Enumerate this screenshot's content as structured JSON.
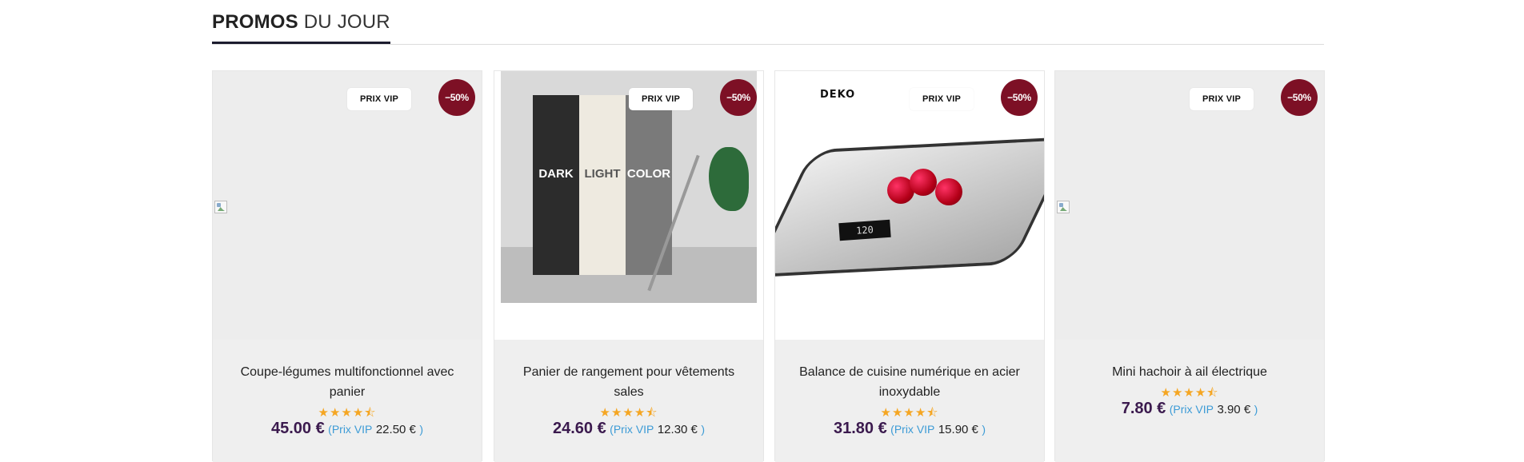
{
  "section": {
    "title_bold": "PROMOS",
    "title_light": "DU JOUR"
  },
  "products": [
    {
      "name": "Coupe-légumes multifonctionnel avec panier",
      "vip_tag": "PRIX VIP",
      "discount": "−50%",
      "rating_stars": "★★★★⯪",
      "rating": 4.5,
      "price": "45.00 €",
      "vip_open": "(Prix VIP",
      "vip_price": "22.50 €",
      "vip_close": ")",
      "image": "broken-image-icon"
    },
    {
      "name": "Panier de rangement pour vêtements sales",
      "vip_tag": "PRIX VIP",
      "discount": "−50%",
      "rating_stars": "★★★★⯪",
      "rating": 4.5,
      "price": "24.60 €",
      "vip_open": "(Prix VIP",
      "vip_price": "12.30 €",
      "vip_close": ")",
      "image": "laundry-hamper-photo",
      "image_labels": [
        "DARK",
        "LIGHT",
        "COLOR"
      ]
    },
    {
      "name": "Balance de cuisine numérique en acier inoxydable",
      "vip_tag": "PRIX VIP",
      "discount": "−50%",
      "rating_stars": "★★★★⯪",
      "rating": 4.5,
      "price": "31.80 €",
      "vip_open": "(Prix VIP",
      "vip_price": "15.90 €",
      "vip_close": ")",
      "image": "kitchen-scale-photo",
      "image_brand": "DEKO",
      "image_display": "120"
    },
    {
      "name": "Mini hachoir à ail électrique",
      "vip_tag": "PRIX VIP",
      "discount": "−50%",
      "rating_stars": "★★★★⯪",
      "rating": 4.5,
      "price": "7.80 €",
      "vip_open": "(Prix VIP",
      "vip_price": "3.90 €",
      "vip_close": ")",
      "image": "broken-image-icon"
    }
  ],
  "colors": {
    "discount_badge": "#7d1025",
    "price": "#3b1a4e",
    "vip_text": "#3c9bd6",
    "stars": "#f5a623",
    "card_bg": "#efefef"
  }
}
